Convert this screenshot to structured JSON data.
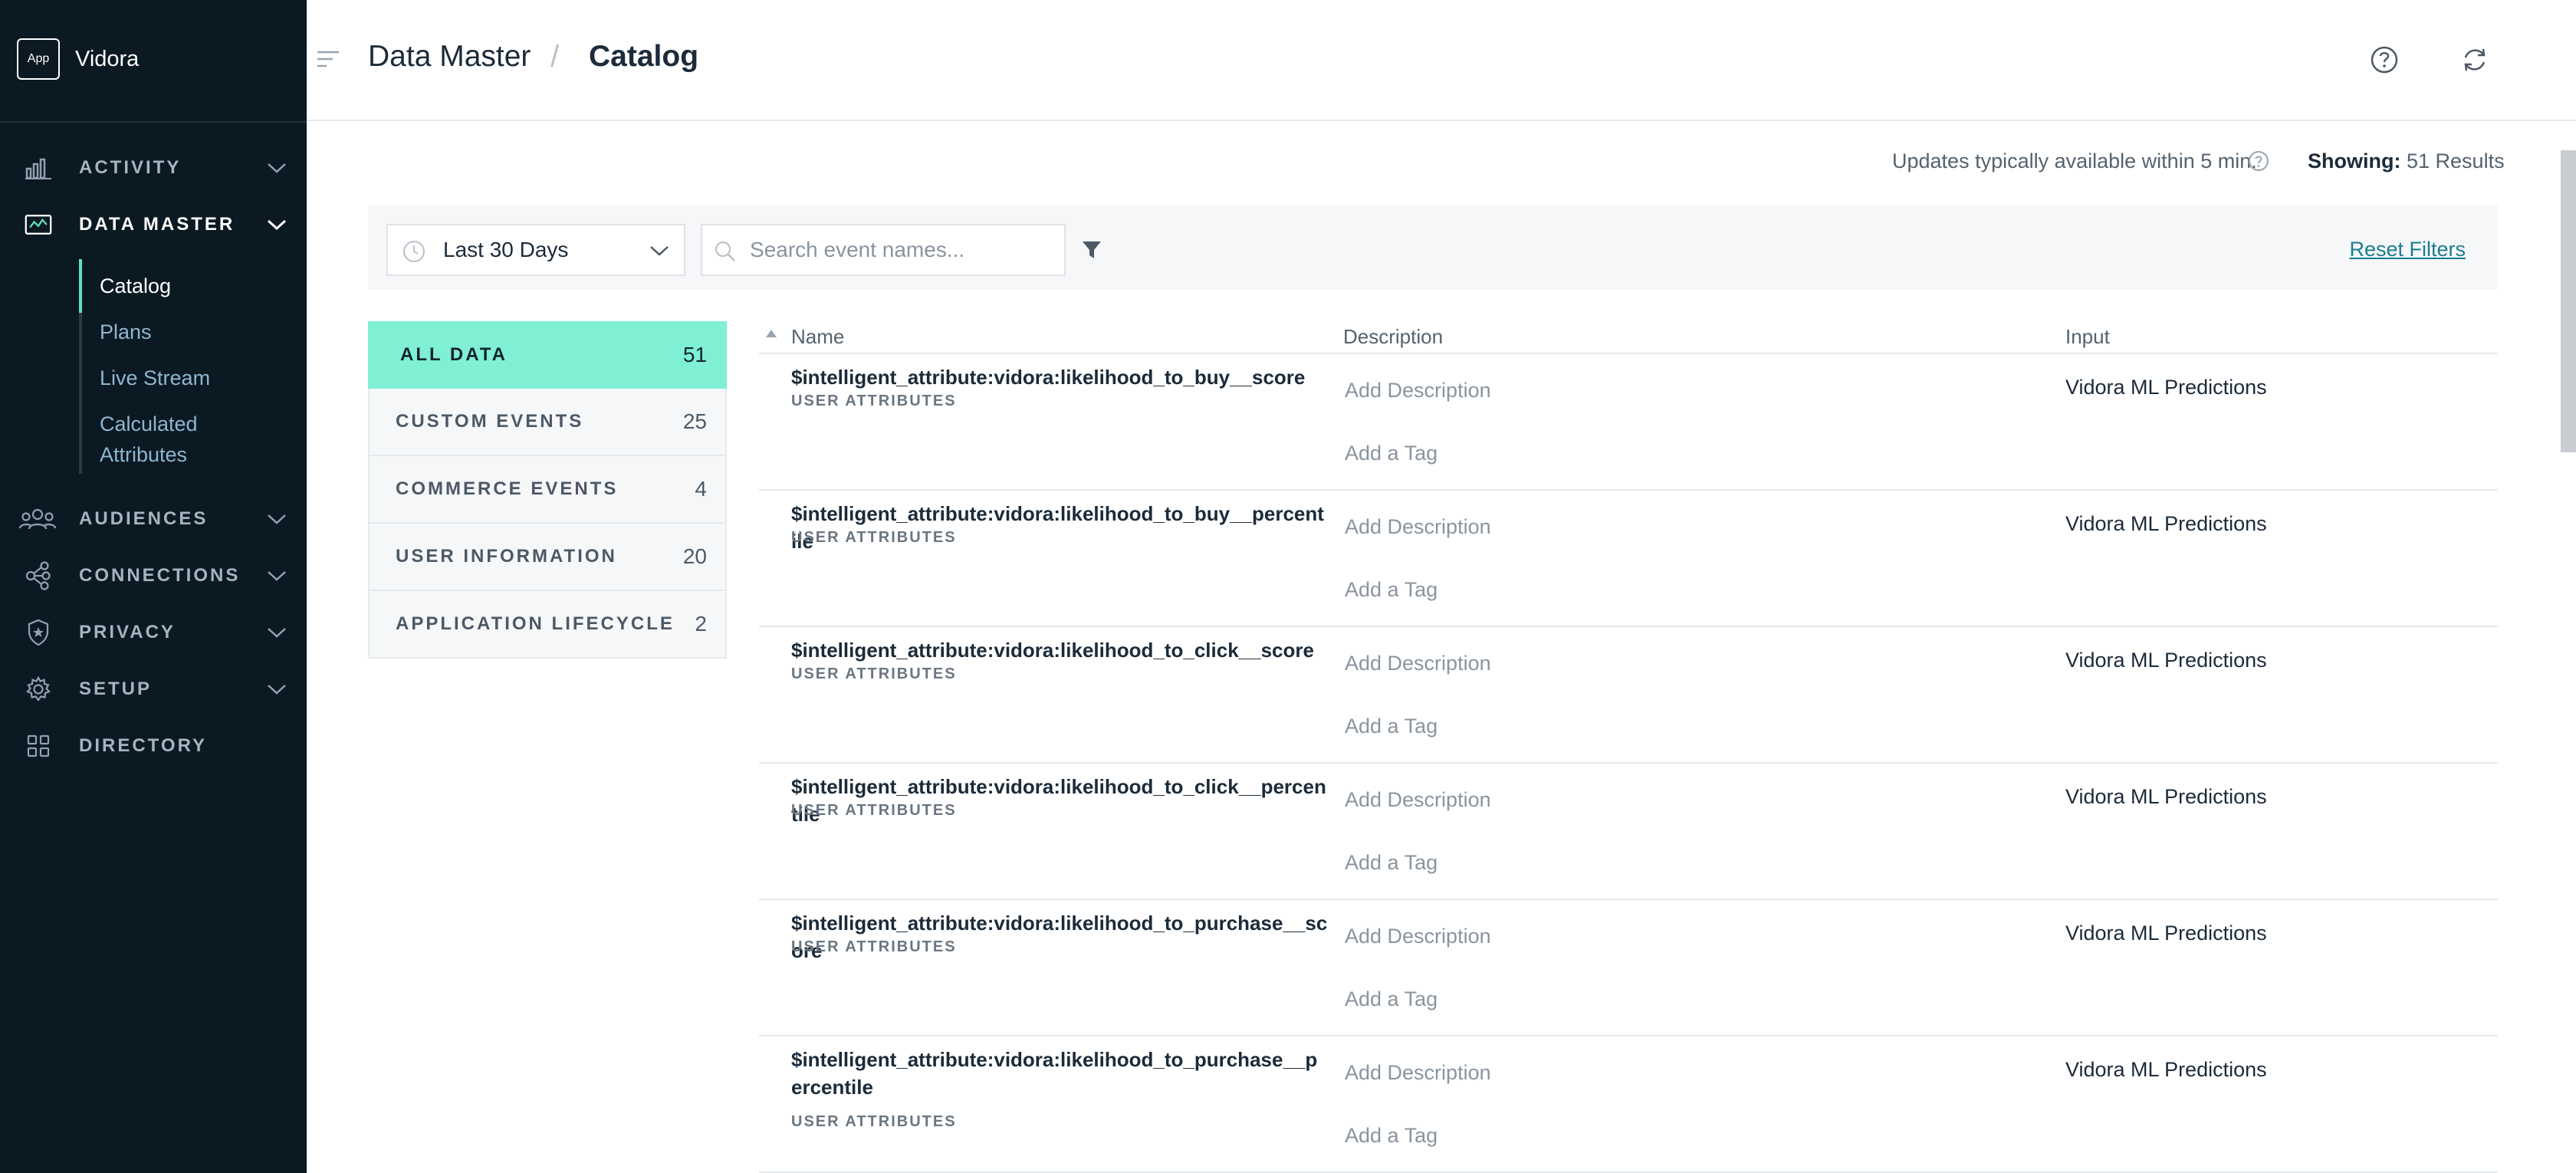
{
  "brand": {
    "logo": "App",
    "name": "Vidora"
  },
  "nav": [
    {
      "label": "ACTIVITY",
      "icon": "bar-chart-icon"
    },
    {
      "label": "DATA MASTER",
      "icon": "data-master-icon",
      "active": true
    },
    {
      "label": "AUDIENCES",
      "icon": "users-icon"
    },
    {
      "label": "CONNECTIONS",
      "icon": "connections-icon"
    },
    {
      "label": "PRIVACY",
      "icon": "shield-icon"
    },
    {
      "label": "SETUP",
      "icon": "gear-icon"
    },
    {
      "label": "DIRECTORY",
      "icon": "grid-icon"
    }
  ],
  "subnav": [
    "Catalog",
    "Plans",
    "Live Stream",
    "Calculated",
    "Attributes"
  ],
  "header": {
    "crumb1": "Data Master",
    "separator": "/",
    "crumb2": "Catalog"
  },
  "status": {
    "updates": "Updates typically available within 5 min.",
    "showing_label": "Showing:",
    "showing_value": "51 Results"
  },
  "filters": {
    "date_range": "Last 30 Days",
    "search_placeholder": "Search event names...",
    "reset": "Reset Filters"
  },
  "categories": [
    {
      "label": "ALL DATA",
      "count": "51",
      "active": true
    },
    {
      "label": "CUSTOM EVENTS",
      "count": "25"
    },
    {
      "label": "COMMERCE EVENTS",
      "count": "4"
    },
    {
      "label": "USER INFORMATION",
      "count": "20"
    },
    {
      "label": "APPLICATION LIFECYCLE",
      "count": "2"
    }
  ],
  "table": {
    "columns": {
      "name": "Name",
      "description": "Description",
      "input": "Input"
    },
    "rows": [
      {
        "name": "$intelligent_attribute:vidora:likelihood_to_buy__score",
        "type": "USER ATTRIBUTES",
        "description": "Add Description",
        "tag": "Add a Tag",
        "input": "Vidora ML Predictions"
      },
      {
        "name": "$intelligent_attribute:vidora:likelihood_to_buy__percentile",
        "type": "USER ATTRIBUTES",
        "description": "Add Description",
        "tag": "Add a Tag",
        "input": "Vidora ML Predictions"
      },
      {
        "name": "$intelligent_attribute:vidora:likelihood_to_click__score",
        "type": "USER ATTRIBUTES",
        "description": "Add Description",
        "tag": "Add a Tag",
        "input": "Vidora ML Predictions"
      },
      {
        "name": "$intelligent_attribute:vidora:likelihood_to_click__percentile",
        "type": "USER ATTRIBUTES",
        "description": "Add Description",
        "tag": "Add a Tag",
        "input": "Vidora ML Predictions"
      },
      {
        "name": "$intelligent_attribute:vidora:likelihood_to_purchase__score",
        "type": "USER ATTRIBUTES",
        "description": "Add Description",
        "tag": "Add a Tag",
        "input": "Vidora ML Predictions"
      },
      {
        "name": "$intelligent_attribute:vidora:likelihood_to_purchase__percentile",
        "type": "USER ATTRIBUTES",
        "description": "Add Description",
        "tag": "Add a Tag",
        "input": "Vidora ML Predictions"
      }
    ]
  },
  "colors": {
    "sidebar_bg": "#0b1923",
    "accent": "#5ce0c6",
    "active_category": "#7ff0d4",
    "link": "#1b7e8e"
  }
}
